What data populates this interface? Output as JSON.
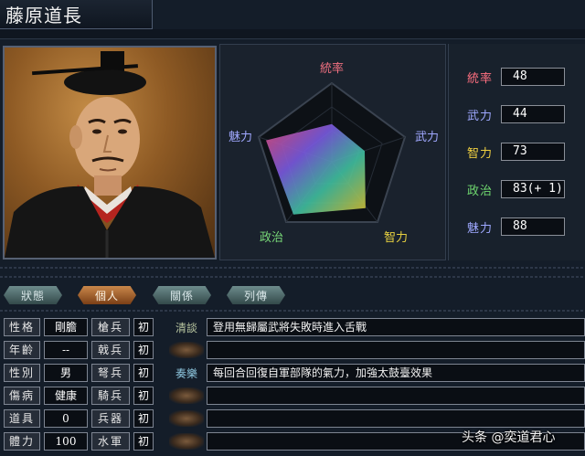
{
  "header": {
    "name": "藤原道長"
  },
  "radar": {
    "labels": {
      "tongshuai": "統率",
      "wuli": "武力",
      "zhili": "智力",
      "zhengzhi": "政治",
      "meili": "魅力"
    },
    "label_colors": {
      "tongshuai": "#f07080",
      "wuli": "#a0a8ff",
      "zhili": "#e6d040",
      "zhengzhi": "#78d878",
      "meili": "#a0a8ff"
    }
  },
  "stats": [
    {
      "label": "統率",
      "value": "48",
      "color": "#ff7080"
    },
    {
      "label": "武力",
      "value": "44",
      "color": "#9ea8ff"
    },
    {
      "label": "智力",
      "value": "73",
      "color": "#f0d040"
    },
    {
      "label": "政治",
      "value": "83(+ 1)",
      "color": "#6fd86f"
    },
    {
      "label": "魅力",
      "value": "88",
      "color": "#9ea8ff"
    }
  ],
  "tabs": [
    "狀態",
    "個人",
    "關係",
    "列傳"
  ],
  "personal": [
    {
      "label": "性格",
      "value": "剛膽"
    },
    {
      "label": "年齡",
      "value": "--"
    },
    {
      "label": "性別",
      "value": "男"
    },
    {
      "label": "傷病",
      "value": "健康"
    },
    {
      "label": "道具",
      "value": "0"
    },
    {
      "label": "體力",
      "value": "100"
    }
  ],
  "troops": [
    {
      "label": "槍兵",
      "rank": "初"
    },
    {
      "label": "戟兵",
      "rank": "初"
    },
    {
      "label": "弩兵",
      "rank": "初"
    },
    {
      "label": "騎兵",
      "rank": "初"
    },
    {
      "label": "兵器",
      "rank": "初"
    },
    {
      "label": "水軍",
      "rank": "初"
    }
  ],
  "skills": [
    {
      "name": "清談",
      "desc": "登用無歸屬武將失敗時進入舌戰"
    },
    {
      "name": "",
      "desc": ""
    },
    {
      "name": "奏樂",
      "desc": "每回合回復自軍部隊的氣力，加強太鼓臺效果"
    },
    {
      "name": "",
      "desc": ""
    },
    {
      "name": "",
      "desc": ""
    },
    {
      "name": "",
      "desc": ""
    }
  ],
  "watermark": "头条 @奕道君心"
}
